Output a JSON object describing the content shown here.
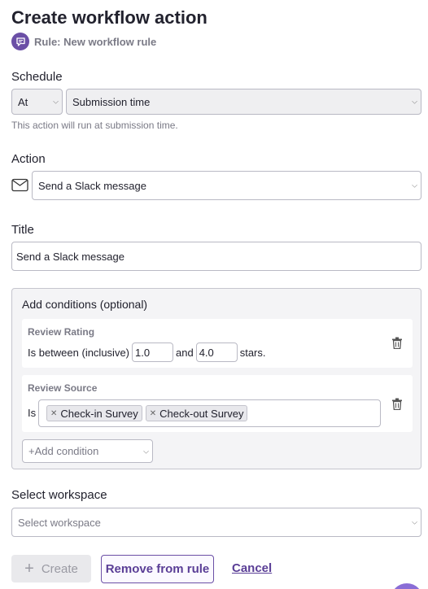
{
  "header": {
    "title": "Create workflow action",
    "rule_label": "Rule: New workflow rule"
  },
  "schedule": {
    "label": "Schedule",
    "timing_value": "At",
    "trigger_value": "Submission time",
    "hint": "This action will run at submission time."
  },
  "action": {
    "label": "Action",
    "value": "Send a Slack message"
  },
  "title_field": {
    "label": "Title",
    "value": "Send a Slack message"
  },
  "conditions": {
    "heading": "Add conditions (optional)",
    "items": [
      {
        "label": "Review Rating",
        "prefix": "Is between (inclusive)",
        "min": "1.0",
        "joiner": "and",
        "max": "4.0",
        "suffix": "stars."
      },
      {
        "label": "Review Source",
        "prefix": "Is",
        "tags": [
          "Check-in Survey",
          "Check-out Survey"
        ]
      }
    ],
    "add_label": "+Add condition"
  },
  "workspace": {
    "label": "Select workspace",
    "placeholder": "Select workspace"
  },
  "footer": {
    "create_label": "Create",
    "remove_label": "Remove from rule",
    "cancel_label": "Cancel"
  },
  "colors": {
    "accent": "#6b4fa6",
    "text": "#22222e",
    "muted": "#7a7a86"
  }
}
